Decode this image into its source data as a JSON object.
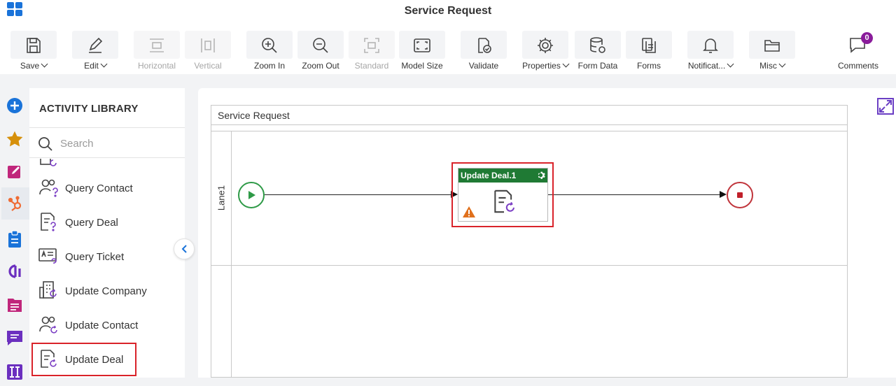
{
  "header": {
    "title": "Service Request"
  },
  "toolbar": {
    "save": "Save",
    "edit": "Edit",
    "horizontal": "Horizontal",
    "vertical": "Vertical",
    "zoom_in": "Zoom In",
    "zoom_out": "Zoom Out",
    "standard": "Standard",
    "model_size": "Model Size",
    "validate": "Validate",
    "properties": "Properties",
    "form_data": "Form Data",
    "forms": "Forms",
    "notifications": "Notificat...",
    "misc": "Misc",
    "comments": "Comments",
    "comments_count": "0"
  },
  "rail": [
    "add-icon",
    "star-icon",
    "edit-note-icon",
    "hubspot-icon",
    "clipboard-icon",
    "analytics-icon",
    "document-icon",
    "message-icon",
    "columns-icon"
  ],
  "library": {
    "title": "ACTIVITY LIBRARY",
    "search_placeholder": "Search",
    "items": [
      {
        "label": "Query Contact"
      },
      {
        "label": "Query Deal"
      },
      {
        "label": "Query Ticket"
      },
      {
        "label": "Update Company"
      },
      {
        "label": "Update Contact"
      },
      {
        "label": "Update Deal"
      }
    ]
  },
  "canvas": {
    "pool_title": "Service Request",
    "lane_label": "Lane1",
    "activity_title": "Update Deal.1"
  },
  "colors": {
    "accent_blue": "#1a73d9",
    "activity_header": "#1f7a34",
    "start_event": "#2e9a47",
    "end_event": "#c0343b",
    "highlight": "#d9232a",
    "badge": "#8a1c9b",
    "library_icon_accent": "#7b3fc4"
  }
}
